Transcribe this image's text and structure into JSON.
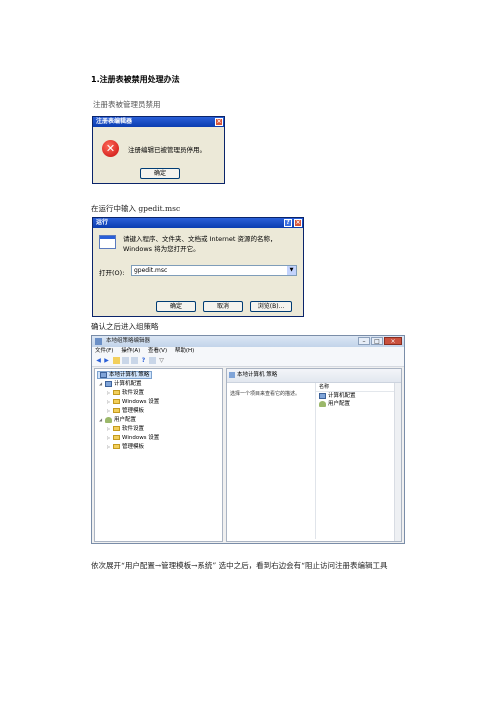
{
  "doc": {
    "heading": "1.注册表被禁用处理办法",
    "para1": "注册表被管理员禁用",
    "para2": "在运行中输入 gpedit.msc",
    "para3": "确认之后进入组策略",
    "para4": "依次展开“用户配置→管理模板→系统”  选中之后，看到右边会有“阻止访问注册表编辑工具"
  },
  "error_dialog": {
    "title": "注册表编辑器",
    "message": "注册编辑已被管理员停用。",
    "ok_label": "确定",
    "icon": "error-x-icon"
  },
  "run_dialog": {
    "title": "运行",
    "description": "请键入程序、文件夹、文档或 Internet 资源的名称，Windows 将为您打开它。",
    "open_label": "打开(O):",
    "input_value": "gpedit.msc",
    "buttons": [
      "确定",
      "取消",
      "浏览(B)..."
    ]
  },
  "gpedit_window": {
    "title": "本地组策略编辑器",
    "menu": [
      "文件(F)",
      "操作(A)",
      "查看(V)",
      "帮助(H)"
    ],
    "tree": {
      "root": "本地计算机 策略",
      "computer": "计算机配置",
      "computer_children": [
        "软件设置",
        "Windows 设置",
        "管理模板"
      ],
      "user": "用户配置",
      "user_children": [
        "软件设置",
        "Windows 设置",
        "管理模板"
      ]
    },
    "right_header": "本地计算机 策略",
    "select_tip": "选择一个项目来查看它的描述。",
    "column_header": "名称",
    "items": [
      "计算机配置",
      "用户配置"
    ]
  }
}
